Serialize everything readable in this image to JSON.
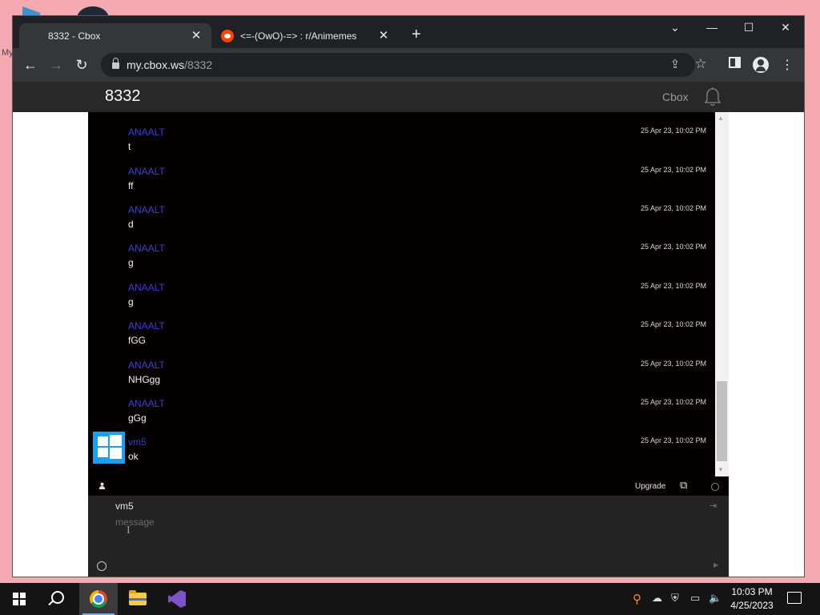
{
  "desktop": {
    "partial_label": "My"
  },
  "browser": {
    "tabs": [
      {
        "title": "8332 - Cbox",
        "close": "✕"
      },
      {
        "title": "<=-(OwO)-=> : r/Animemes",
        "close": "✕"
      }
    ],
    "new_tab": "+",
    "window_controls": {
      "dropdown": "⌄",
      "minimize": "—",
      "maximize": "☐",
      "close": "✕"
    },
    "nav": {
      "back": "←",
      "forward": "→",
      "reload": "↻"
    },
    "url_host": "my.cbox.ws",
    "url_path": "/8332"
  },
  "cbox": {
    "title": "8332",
    "link": "Cbox",
    "messages": [
      {
        "name": "ANAALT",
        "text": "t",
        "time": "25 Apr 23, 10:02 PM"
      },
      {
        "name": "ANAALT",
        "text": "ff",
        "time": "25 Apr 23, 10:02 PM"
      },
      {
        "name": "ANAALT",
        "text": "d",
        "time": "25 Apr 23, 10:02 PM"
      },
      {
        "name": "ANAALT",
        "text": "g",
        "time": "25 Apr 23, 10:02 PM"
      },
      {
        "name": "ANAALT",
        "text": "g",
        "time": "25 Apr 23, 10:02 PM"
      },
      {
        "name": "ANAALT",
        "text": "fGG",
        "time": "25 Apr 23, 10:02 PM"
      },
      {
        "name": "ANAALT",
        "text": "NHGgg",
        "time": "25 Apr 23, 10:02 PM"
      },
      {
        "name": "ANAALT",
        "text": "gGg",
        "time": "25 Apr 23, 10:02 PM"
      },
      {
        "name": "vm5",
        "text": "ok",
        "time": "25 Apr 23, 10:02 PM"
      }
    ],
    "upgrade_label": "Upgrade",
    "form": {
      "name_value": "vm5",
      "message_placeholder": "message"
    },
    "colors": {
      "username": "#3d3dd6",
      "background": "#040002"
    }
  },
  "taskbar": {
    "time": "10:03 PM",
    "date": "4/25/2023"
  }
}
